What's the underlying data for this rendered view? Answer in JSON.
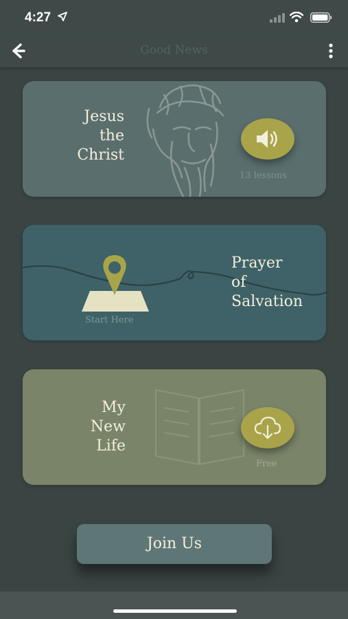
{
  "status_bar": {
    "time": "4:27"
  },
  "nav": {
    "title": "Good News"
  },
  "cards": [
    {
      "title": "Jesus\nthe\nChrist",
      "subtitle": "13 lessons",
      "button_icon": "speaker-icon"
    },
    {
      "title": "Prayer\nof\nSalvation",
      "subtitle": "Start Here",
      "icon": "map-pin-icon"
    },
    {
      "title": "My\nNew\nLife",
      "subtitle": "Free",
      "button_icon": "cloud-download-icon"
    }
  ],
  "join_button": {
    "label": "Join Us"
  },
  "colors": {
    "background": "#3a4543",
    "card_1": "#5a6e6e",
    "card_2": "#3e6267",
    "card_3": "#7a8468",
    "accent": "#a9a44a",
    "text": "#f3efdc"
  }
}
